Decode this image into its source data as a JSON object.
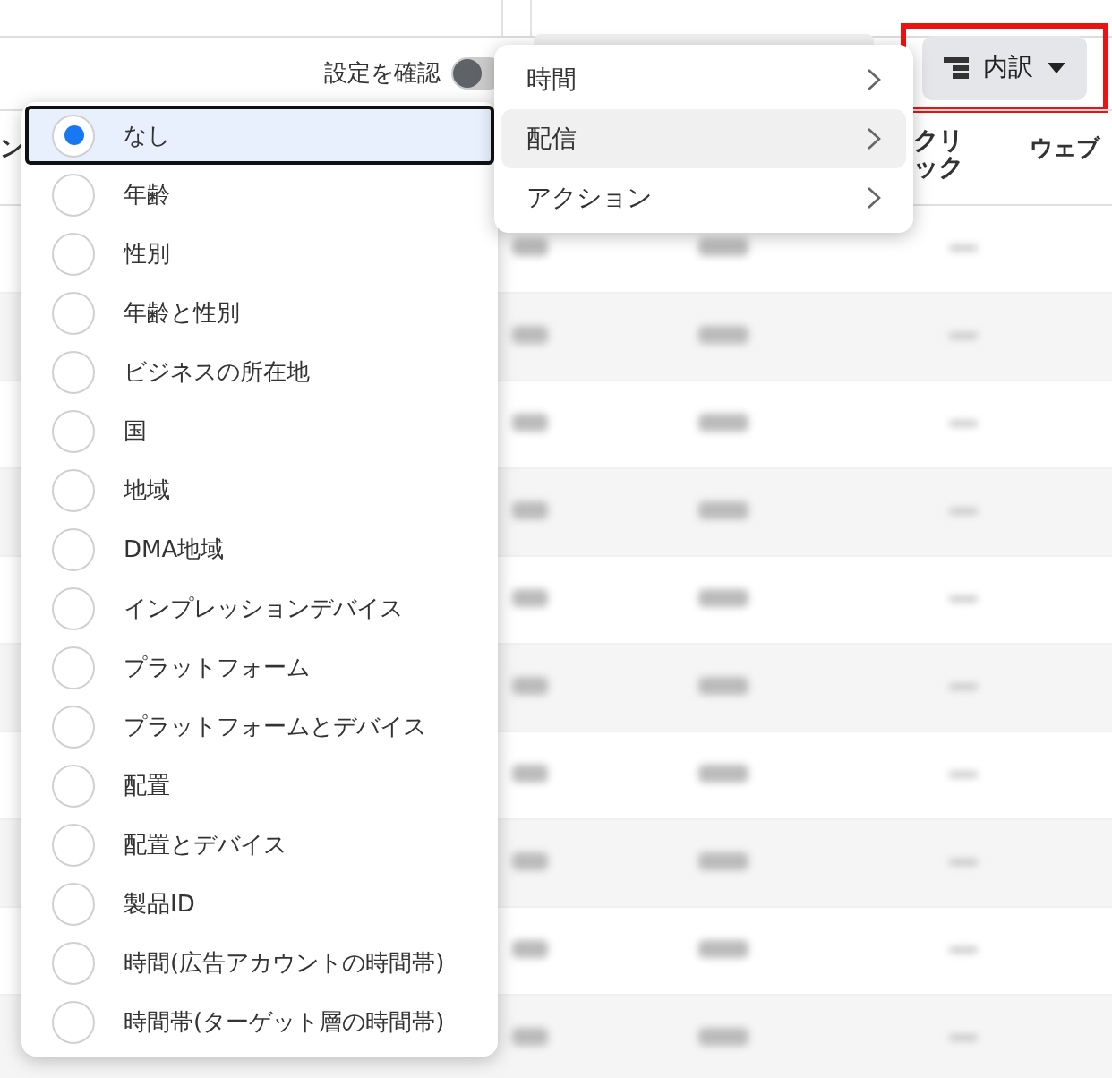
{
  "toolbar": {
    "review_label": "設定を確認",
    "review_toggle": {
      "on": false
    },
    "breakdown_button": {
      "label": "内訳",
      "highlighted": true
    }
  },
  "table": {
    "columns": [
      {
        "label": "ン"
      },
      {
        "label": "クリック"
      },
      {
        "label": "ウェブ"
      }
    ]
  },
  "breakdown_menu": {
    "items": [
      {
        "label": "なし",
        "selected": true
      },
      {
        "label": "年齢",
        "selected": false
      },
      {
        "label": "性別",
        "selected": false
      },
      {
        "label": "年齢と性別",
        "selected": false
      },
      {
        "label": "ビジネスの所在地",
        "selected": false
      },
      {
        "label": "国",
        "selected": false
      },
      {
        "label": "地域",
        "selected": false
      },
      {
        "label": "DMA地域",
        "selected": false
      },
      {
        "label": "インプレッションデバイス",
        "selected": false
      },
      {
        "label": "プラットフォーム",
        "selected": false
      },
      {
        "label": "プラットフォームとデバイス",
        "selected": false
      },
      {
        "label": "配置",
        "selected": false
      },
      {
        "label": "配置とデバイス",
        "selected": false
      },
      {
        "label": "製品ID",
        "selected": false
      },
      {
        "label": "時間(広告アカウントの時間帯)",
        "selected": false
      },
      {
        "label": "時間帯(ターゲット層の時間帯)",
        "selected": false
      }
    ]
  },
  "category_menu": {
    "items": [
      {
        "label": "時間",
        "hovered": false
      },
      {
        "label": "配信",
        "hovered": true
      },
      {
        "label": "アクション",
        "hovered": false
      }
    ]
  }
}
